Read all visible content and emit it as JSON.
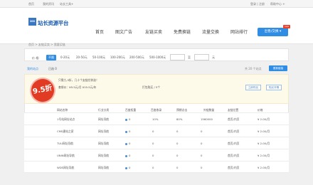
{
  "topbar": {
    "home": "首页",
    "account": "我的资讯",
    "join": "站长工具+",
    "login": "登录 | 注册",
    "help": "帮助中心 +"
  },
  "header": {
    "logo_box": "200",
    "logo_text": "站长资源平台"
  },
  "nav": [
    "首页",
    "图文广告",
    "友链买卖",
    "免费换链",
    "流量交换",
    "网站排行"
  ],
  "main_button": "出售/交换 ▾",
  "new_badge": "new",
  "breadcrumb": "首页 > 友链买卖 > 我要买链",
  "filter": {
    "label": "价 格:",
    "options": [
      "不限",
      "0-20元",
      "20-50元",
      "50-100元",
      "100-200元",
      "200-500元",
      "500-1000元"
    ],
    "active_index": 0,
    "separator": "至",
    "unit": "元"
  },
  "tabs": {
    "left": "我的站点",
    "middle": "已选 0",
    "right_text": "共 20 个站点",
    "right_button": "更新链接"
  },
  "promo": {
    "seal": "9.5折",
    "line1": "只需九.5折，几十个友链任你选！",
    "line2": "套餐价：¥9.5元/月 ¥19.5元/年",
    "line3": "打包购买 / 5个",
    "btn1": "立即购买",
    "btn2": "购买详情"
  },
  "table": {
    "headers": [
      "网站名称",
      "行业分类",
      "百度权重",
      "百度收录",
      "预期点击",
      "外链数量",
      "友链位置",
      "价格"
    ],
    "rows": [
      [
        "1号站网址站点",
        "网址导航",
        "0",
        "10%",
        "80%",
        "1560000",
        "首页/内页",
        "¥ 2.00/月"
      ],
      [
        "CMS建站之家",
        "网址导航",
        "0",
        "0",
        "0",
        "0",
        "首页/内页",
        "¥ 2.00/月"
      ],
      [
        "TUU网址导航",
        "网址导航",
        "0",
        "0",
        "0",
        "0",
        "首页/内页",
        "¥ 2.00/月"
      ],
      [
        "UNIN网址导航",
        "网址导航",
        "0",
        "0",
        "0",
        "0",
        "首页/内页",
        "¥ 2.00/月"
      ],
      [
        "WDS网址导航",
        "网址导航",
        "0",
        "0",
        "0",
        "0",
        "首页/内页",
        "¥ 2.00/月"
      ]
    ]
  },
  "colors": {
    "primary": "#2f8de4",
    "red": "#e13b24",
    "promo_bg": "#fdfaea"
  }
}
